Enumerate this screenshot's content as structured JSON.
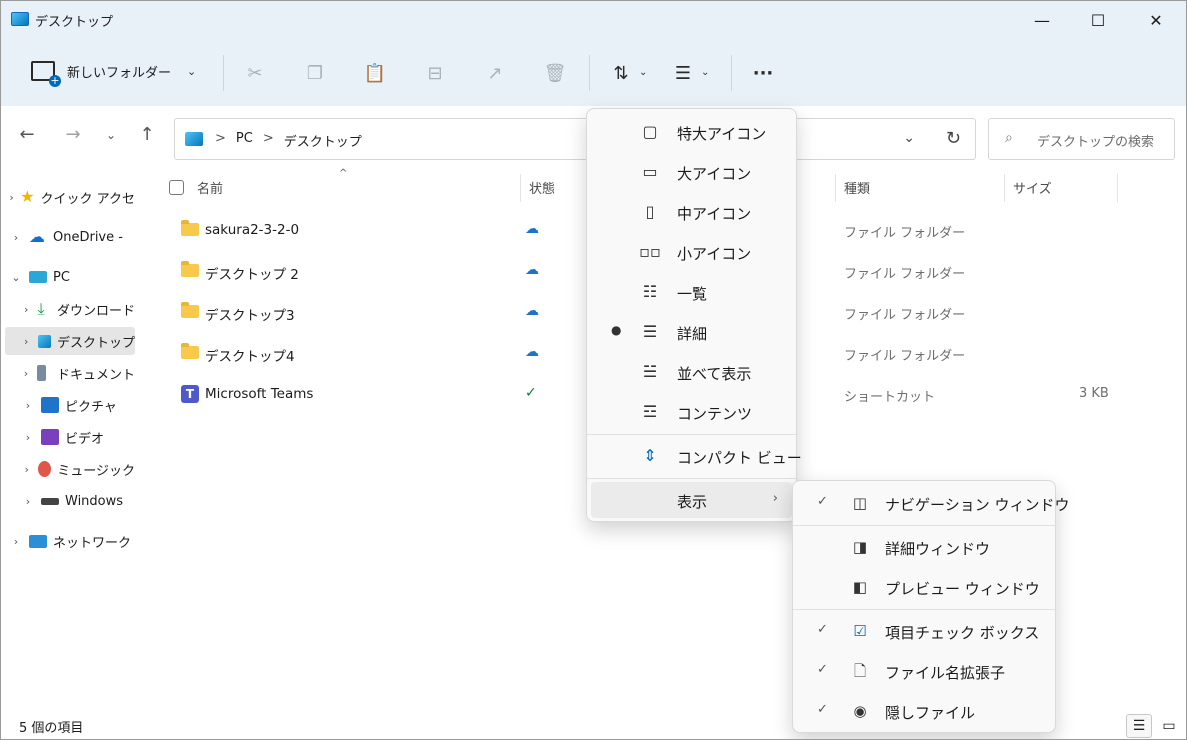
{
  "window": {
    "title": "デスクトップ",
    "minimize": "—",
    "maximize": "☐",
    "close": "✕"
  },
  "toolbar": {
    "new_folder_label": "新しいフォルダー",
    "icons": [
      "new-folder-icon",
      "cut-icon",
      "copy-icon",
      "paste-icon",
      "rename-icon",
      "share-icon",
      "delete-icon",
      "sort-icon",
      "view-icon",
      "more-icon"
    ]
  },
  "address": {
    "crumbs": [
      "PC",
      "デスクトップ"
    ],
    "separator": ">"
  },
  "search": {
    "placeholder": "デスクトップの検索"
  },
  "sidebar": {
    "items": [
      {
        "label": "クイック アクセ",
        "icon": "star-icon",
        "color": "#f2b400"
      },
      {
        "label": "OneDrive -",
        "icon": "cloud-icon",
        "color": "#1170cf"
      },
      {
        "label": "PC",
        "icon": "computer-icon",
        "color": "#2aa7d6"
      },
      {
        "label": "ダウンロード",
        "icon": "download-icon",
        "color": "#1a9c5b"
      },
      {
        "label": "デスクトップ",
        "icon": "desktop-icon",
        "color": "#1e88c6"
      },
      {
        "label": "ドキュメント",
        "icon": "document-icon",
        "color": "#7a8aa0"
      },
      {
        "label": "ピクチャ",
        "icon": "pictures-icon",
        "color": "#1e74c9"
      },
      {
        "label": "ビデオ",
        "icon": "video-icon",
        "color": "#7a3fbf"
      },
      {
        "label": "ミュージック",
        "icon": "music-icon",
        "color": "#e0564a"
      },
      {
        "label": "Windows",
        "icon": "drive-icon",
        "color": "#444444"
      },
      {
        "label": "ネットワーク",
        "icon": "network-icon",
        "color": "#2a8fd6"
      }
    ]
  },
  "columns": {
    "name": "名前",
    "status": "状態",
    "type": "種類",
    "size": "サイズ"
  },
  "files": [
    {
      "name": "sakura2-3-2-0",
      "type": "ファイル フォルダー",
      "size": "",
      "status": "cloud"
    },
    {
      "name": "デスクトップ 2",
      "type": "ファイル フォルダー",
      "size": "",
      "status": "cloud"
    },
    {
      "name": "デスクトップ3",
      "type": "ファイル フォルダー",
      "size": "",
      "status": "cloud"
    },
    {
      "name": "デスクトップ4",
      "type": "ファイル フォルダー",
      "size": "",
      "status": "cloud"
    },
    {
      "name": "Microsoft Teams",
      "type": "ショートカット",
      "size": "3 KB",
      "status": "synced"
    }
  ],
  "status_bar": {
    "item_count": "5 個の項目"
  },
  "view_menu": {
    "items": [
      {
        "label": "特大アイコン",
        "icon": "extra-large-icons-icon"
      },
      {
        "label": "大アイコン",
        "icon": "large-icons-icon"
      },
      {
        "label": "中アイコン",
        "icon": "medium-icons-icon"
      },
      {
        "label": "小アイコン",
        "icon": "small-icons-icon"
      },
      {
        "label": "一覧",
        "icon": "list-icon"
      },
      {
        "label": "詳細",
        "icon": "details-icon",
        "selected": true
      },
      {
        "label": "並べて表示",
        "icon": "tiles-icon"
      },
      {
        "label": "コンテンツ",
        "icon": "content-icon"
      },
      {
        "label": "コンパクト ビュー",
        "icon": "compact-view-icon"
      },
      {
        "label": "表示",
        "icon": "",
        "submenu": true
      }
    ]
  },
  "show_submenu": {
    "items": [
      {
        "label": "ナビゲーション ウィンドウ",
        "icon": "navigation-pane-icon",
        "checked": true
      },
      {
        "label": "詳細ウィンドウ",
        "icon": "details-pane-icon",
        "checked": false
      },
      {
        "label": "プレビュー ウィンドウ",
        "icon": "preview-pane-icon",
        "checked": false
      },
      {
        "label": "項目チェック ボックス",
        "icon": "item-checkbox-icon",
        "checked": true
      },
      {
        "label": "ファイル名拡張子",
        "icon": "file-extension-icon",
        "checked": true
      },
      {
        "label": "隠しファイル",
        "icon": "hidden-files-icon",
        "checked": true
      }
    ]
  },
  "colors": {
    "accent": "#0067c0",
    "chrome_bg": "#e8f1f7",
    "folder": "#f8c94a"
  }
}
